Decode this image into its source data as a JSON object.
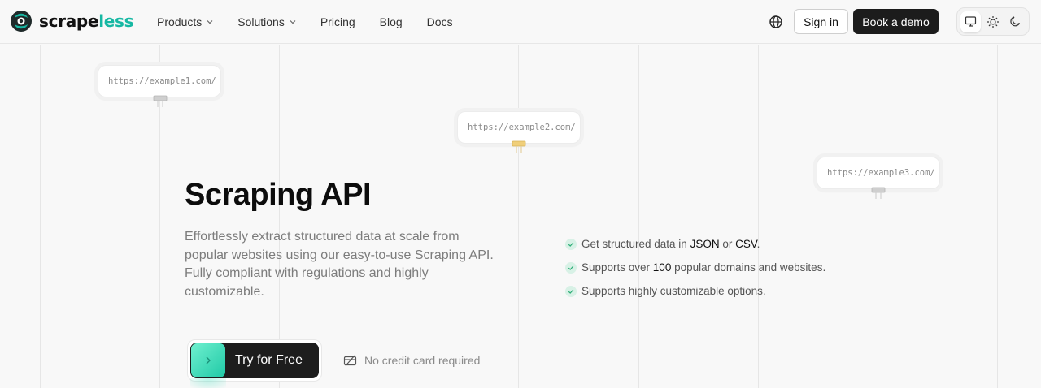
{
  "header": {
    "logo": {
      "text_main": "scrape",
      "text_accent": "less",
      "brand_color": "#16b8a3"
    },
    "nav": [
      {
        "label": "Products",
        "has_dropdown": true
      },
      {
        "label": "Solutions",
        "has_dropdown": true
      },
      {
        "label": "Pricing",
        "has_dropdown": false
      },
      {
        "label": "Blog",
        "has_dropdown": false
      },
      {
        "label": "Docs",
        "has_dropdown": false
      }
    ],
    "language_icon": "globe-icon",
    "sign_in_label": "Sign in",
    "book_demo_label": "Book a demo",
    "theme_options": [
      {
        "icon": "monitor-icon",
        "active": true
      },
      {
        "icon": "sun-icon",
        "active": false
      },
      {
        "icon": "moon-icon",
        "active": false
      }
    ]
  },
  "url_cards": [
    {
      "url": "https://example1.com/",
      "plug_color": "#c9c9c9"
    },
    {
      "url": "https://example2.com/",
      "plug_color": "#e8c774"
    },
    {
      "url": "https://example3.com/",
      "plug_color": "#c9c9c9"
    }
  ],
  "hero": {
    "title": "Scraping API",
    "description": "Effortlessly extract structured data at scale from popular websites using our easy-to-use Scraping API. Fully compliant with regulations and highly customizable.",
    "features": [
      {
        "parts": [
          "Get structured data in ",
          "JSON",
          " or ",
          "CSV",
          "."
        ]
      },
      {
        "parts": [
          "Supports over ",
          "100",
          " popular domains and websites."
        ]
      },
      {
        "parts": [
          "Supports highly customizable options."
        ]
      }
    ],
    "cta_label": "Try for Free",
    "no_card_text": "No credit card required",
    "no_card_icon": "credit-card-off-icon",
    "check_color": "#3fbf8a"
  }
}
